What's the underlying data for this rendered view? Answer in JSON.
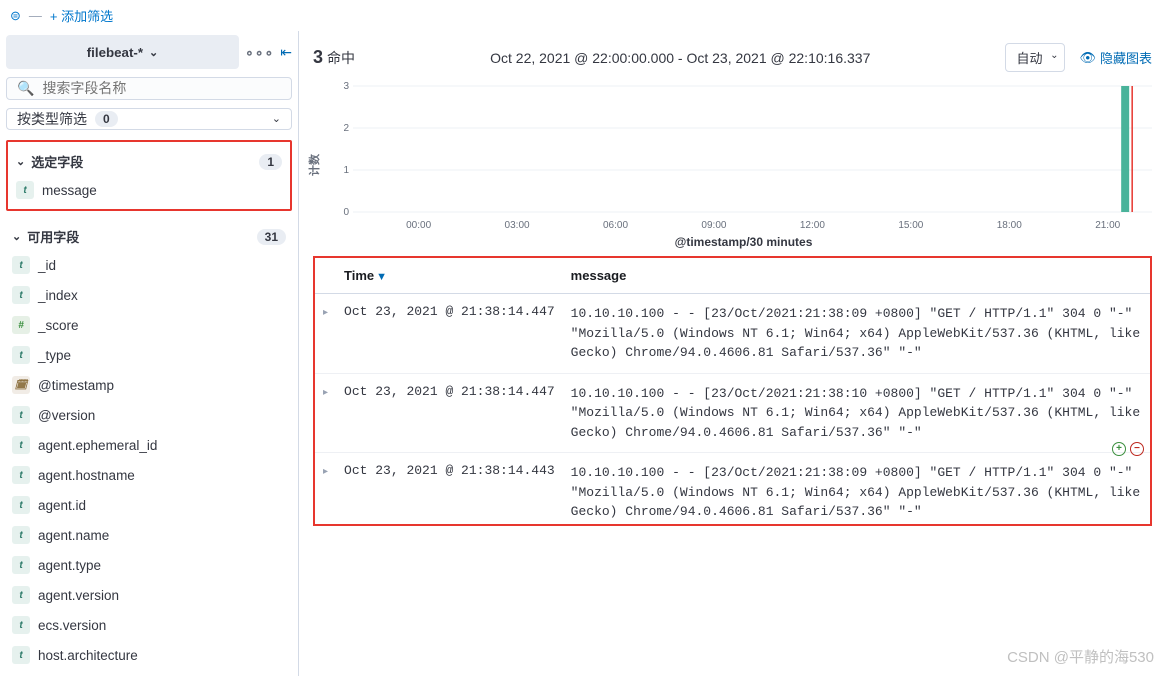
{
  "topbar": {
    "add_filter": "+ 添加筛选"
  },
  "sidebar": {
    "index_pattern": "filebeat-*",
    "search_placeholder": "搜索字段名称",
    "filter_by_type": "按类型筛选",
    "filter_by_type_count": "0",
    "selected_fields_label": "选定字段",
    "selected_fields_count": "1",
    "selected_fields": [
      {
        "type": "t",
        "name": "message"
      }
    ],
    "available_fields_label": "可用字段",
    "available_fields_count": "31",
    "available_fields": [
      {
        "type": "t",
        "name": "_id"
      },
      {
        "type": "t",
        "name": "_index"
      },
      {
        "type": "#",
        "name": "_score"
      },
      {
        "type": "t",
        "name": "_type"
      },
      {
        "type": "d",
        "name": "@timestamp"
      },
      {
        "type": "t",
        "name": "@version"
      },
      {
        "type": "t",
        "name": "agent.ephemeral_id"
      },
      {
        "type": "t",
        "name": "agent.hostname"
      },
      {
        "type": "t",
        "name": "agent.id"
      },
      {
        "type": "t",
        "name": "agent.name"
      },
      {
        "type": "t",
        "name": "agent.type"
      },
      {
        "type": "t",
        "name": "agent.version"
      },
      {
        "type": "t",
        "name": "ecs.version"
      },
      {
        "type": "t",
        "name": "host.architecture"
      }
    ]
  },
  "header": {
    "hits_count": "3",
    "hits_label": "命中",
    "daterange": "Oct 22, 2021 @ 22:00:00.000 - Oct 23, 2021 @ 22:10:16.337",
    "interval": "自动",
    "hide_chart": "隐藏图表"
  },
  "chart_data": {
    "type": "bar",
    "ylabel": "计数",
    "xlabel": "@timestamp/30 minutes",
    "ylim": [
      0,
      3
    ],
    "yticks": [
      0,
      1,
      2,
      3
    ],
    "x_categories": [
      "00:00",
      "03:00",
      "06:00",
      "09:00",
      "12:00",
      "15:00",
      "18:00",
      "21:00"
    ],
    "bars": [
      {
        "x_label": "21:30",
        "value": 3
      }
    ]
  },
  "table": {
    "columns": {
      "time": "Time",
      "message": "message"
    },
    "rows": [
      {
        "time": "Oct 23, 2021 @ 21:38:14.447",
        "message": "10.10.10.100 - - [23/Oct/2021:21:38:09 +0800] \"GET / HTTP/1.1\" 304 0 \"-\" \"Mozilla/5.0 (Windows NT 6.1; Win64; x64) AppleWebKit/537.36 (KHTML, like Gecko) Chrome/94.0.4606.81 Safari/537.36\" \"-\""
      },
      {
        "time": "Oct 23, 2021 @ 21:38:14.447",
        "message": "10.10.10.100 - - [23/Oct/2021:21:38:10 +0800] \"GET / HTTP/1.1\" 304 0 \"-\" \"Mozilla/5.0 (Windows NT 6.1; Win64; x64) AppleWebKit/537.36 (KHTML, like Gecko) Chrome/94.0.4606.81 Safari/537.36\" \"-\""
      },
      {
        "time": "Oct 23, 2021 @ 21:38:14.443",
        "message": "10.10.10.100 - - [23/Oct/2021:21:38:09 +0800] \"GET / HTTP/1.1\" 304 0 \"-\" \"Mozilla/5.0 (Windows NT 6.1; Win64; x64) AppleWebKit/537.36 (KHTML, like Gecko) Chrome/94.0.4606.81 Safari/537.36\" \"-\""
      }
    ]
  },
  "watermark": "CSDN @平静的海530"
}
